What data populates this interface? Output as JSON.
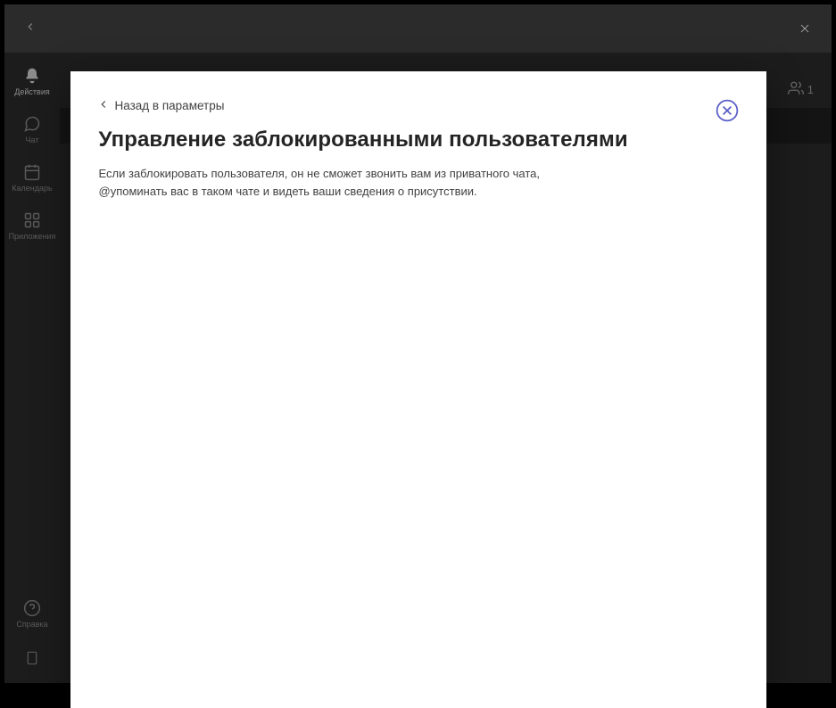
{
  "titlebar": {},
  "sidebar": {
    "items": [
      {
        "label": "Действия",
        "icon": "bell"
      },
      {
        "label": "Чат",
        "icon": "chat"
      },
      {
        "label": "Календарь",
        "icon": "calendar"
      },
      {
        "label": "Приложения",
        "icon": "apps"
      }
    ],
    "help": {
      "label": "Справка"
    }
  },
  "topbar": {
    "people_count": "1"
  },
  "modal": {
    "back_label": "Назад в параметры",
    "title": "Управление заблокированными пользователями",
    "description": "Если заблокировать пользователя, он не сможет звонить вам из приватного чата, @упоминать вас в таком чате и видеть ваши сведения о присутствии."
  }
}
